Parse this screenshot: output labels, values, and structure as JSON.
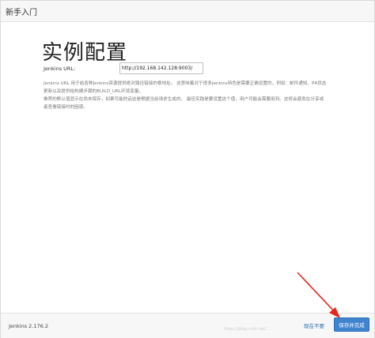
{
  "header": {
    "title": "新手入门"
  },
  "main": {
    "title": "实例配置",
    "url_label": "Jenkins URL:",
    "url_value": "http://192.168.142.128:9003/",
    "help_lines": [
      "Jenkins URL 用于给各种Jenkins资源提供绝对路径链接的根地址。 这意味着对于很多Jenkins特色是需要正确设置的，例如：邮件通知、PR状态",
      "更新以及提供给构建步骤的BUILD_URL环境变量。",
      "推荐的默认值显示在尚未保存，如果可能的话这是根据当前请求生成的。 最佳实践是要设置这个值，用户可能会需要用到。这将会避免在分享或",
      "者查看链接时的困惑。"
    ]
  },
  "footer": {
    "version": "Jenkins 2.176.2",
    "skip_label": "现在不要",
    "save_label": "保存并完成"
  },
  "watermark": "https://blog.csdn.net/...",
  "colors": {
    "primary_button": "#3f84cf",
    "link": "#2b6cb0",
    "annotation_arrow": "#e8251f"
  }
}
